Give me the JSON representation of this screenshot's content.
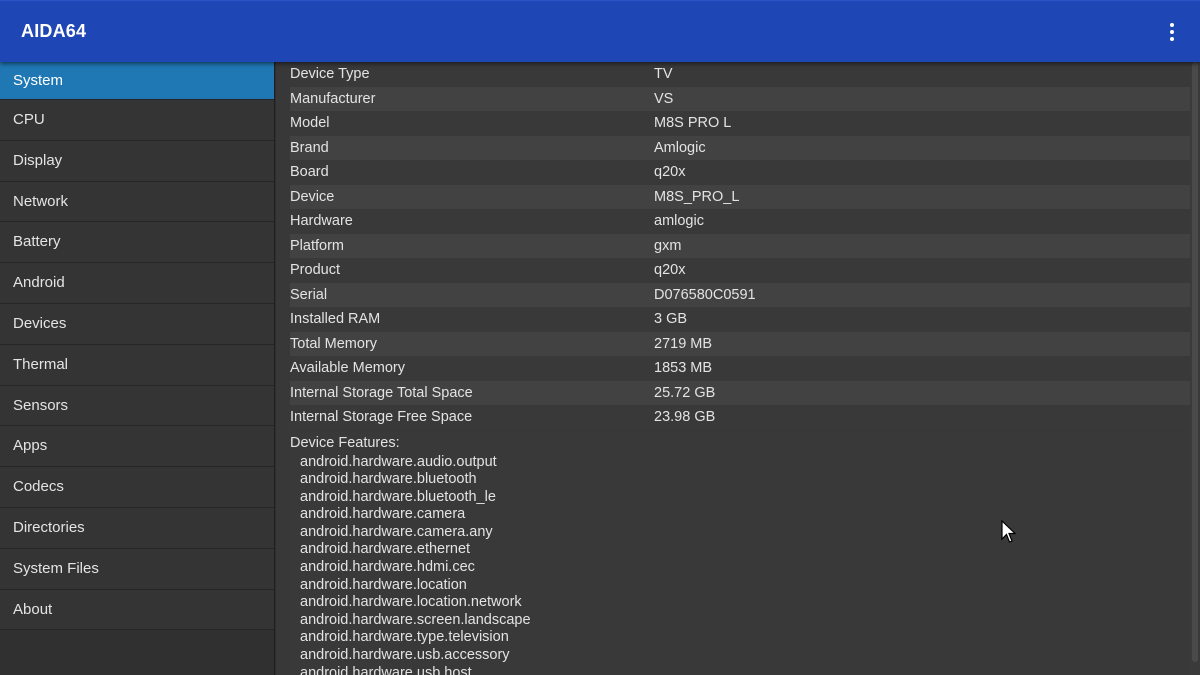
{
  "app": {
    "title": "AIDA64"
  },
  "sidebar": {
    "items": [
      {
        "label": "System",
        "active": true
      },
      {
        "label": "CPU"
      },
      {
        "label": "Display"
      },
      {
        "label": "Network"
      },
      {
        "label": "Battery"
      },
      {
        "label": "Android"
      },
      {
        "label": "Devices"
      },
      {
        "label": "Thermal"
      },
      {
        "label": "Sensors"
      },
      {
        "label": "Apps"
      },
      {
        "label": "Codecs"
      },
      {
        "label": "Directories"
      },
      {
        "label": "System Files"
      },
      {
        "label": "About"
      }
    ]
  },
  "system": {
    "properties": [
      {
        "name": "Device Type",
        "value": "TV"
      },
      {
        "name": "Manufacturer",
        "value": "VS"
      },
      {
        "name": "Model",
        "value": "M8S PRO L"
      },
      {
        "name": "Brand",
        "value": "Amlogic"
      },
      {
        "name": "Board",
        "value": "q20x"
      },
      {
        "name": "Device",
        "value": "M8S_PRO_L"
      },
      {
        "name": "Hardware",
        "value": "amlogic"
      },
      {
        "name": "Platform",
        "value": "gxm"
      },
      {
        "name": "Product",
        "value": "q20x"
      },
      {
        "name": "Serial",
        "value": "D076580C0591"
      },
      {
        "name": "Installed RAM",
        "value": "3 GB"
      },
      {
        "name": "Total Memory",
        "value": "2719 MB"
      },
      {
        "name": "Available Memory",
        "value": "1853 MB"
      },
      {
        "name": "Internal Storage Total Space",
        "value": "25.72 GB"
      },
      {
        "name": "Internal Storage Free Space",
        "value": "23.98 GB"
      }
    ],
    "features_title": "Device Features:",
    "features": [
      "android.hardware.audio.output",
      "android.hardware.bluetooth",
      "android.hardware.bluetooth_le",
      "android.hardware.camera",
      "android.hardware.camera.any",
      "android.hardware.ethernet",
      "android.hardware.hdmi.cec",
      "android.hardware.location",
      "android.hardware.location.network",
      "android.hardware.screen.landscape",
      "android.hardware.type.television",
      "android.hardware.usb.accessory",
      "android.hardware.usb.host"
    ]
  },
  "colors": {
    "appbar": "#1e46b4",
    "active_item": "#1f78b4",
    "background": "#2f2f2f"
  },
  "icons": {
    "overflow": "more-vert-icon",
    "cursor": "mouse-pointer-icon"
  }
}
